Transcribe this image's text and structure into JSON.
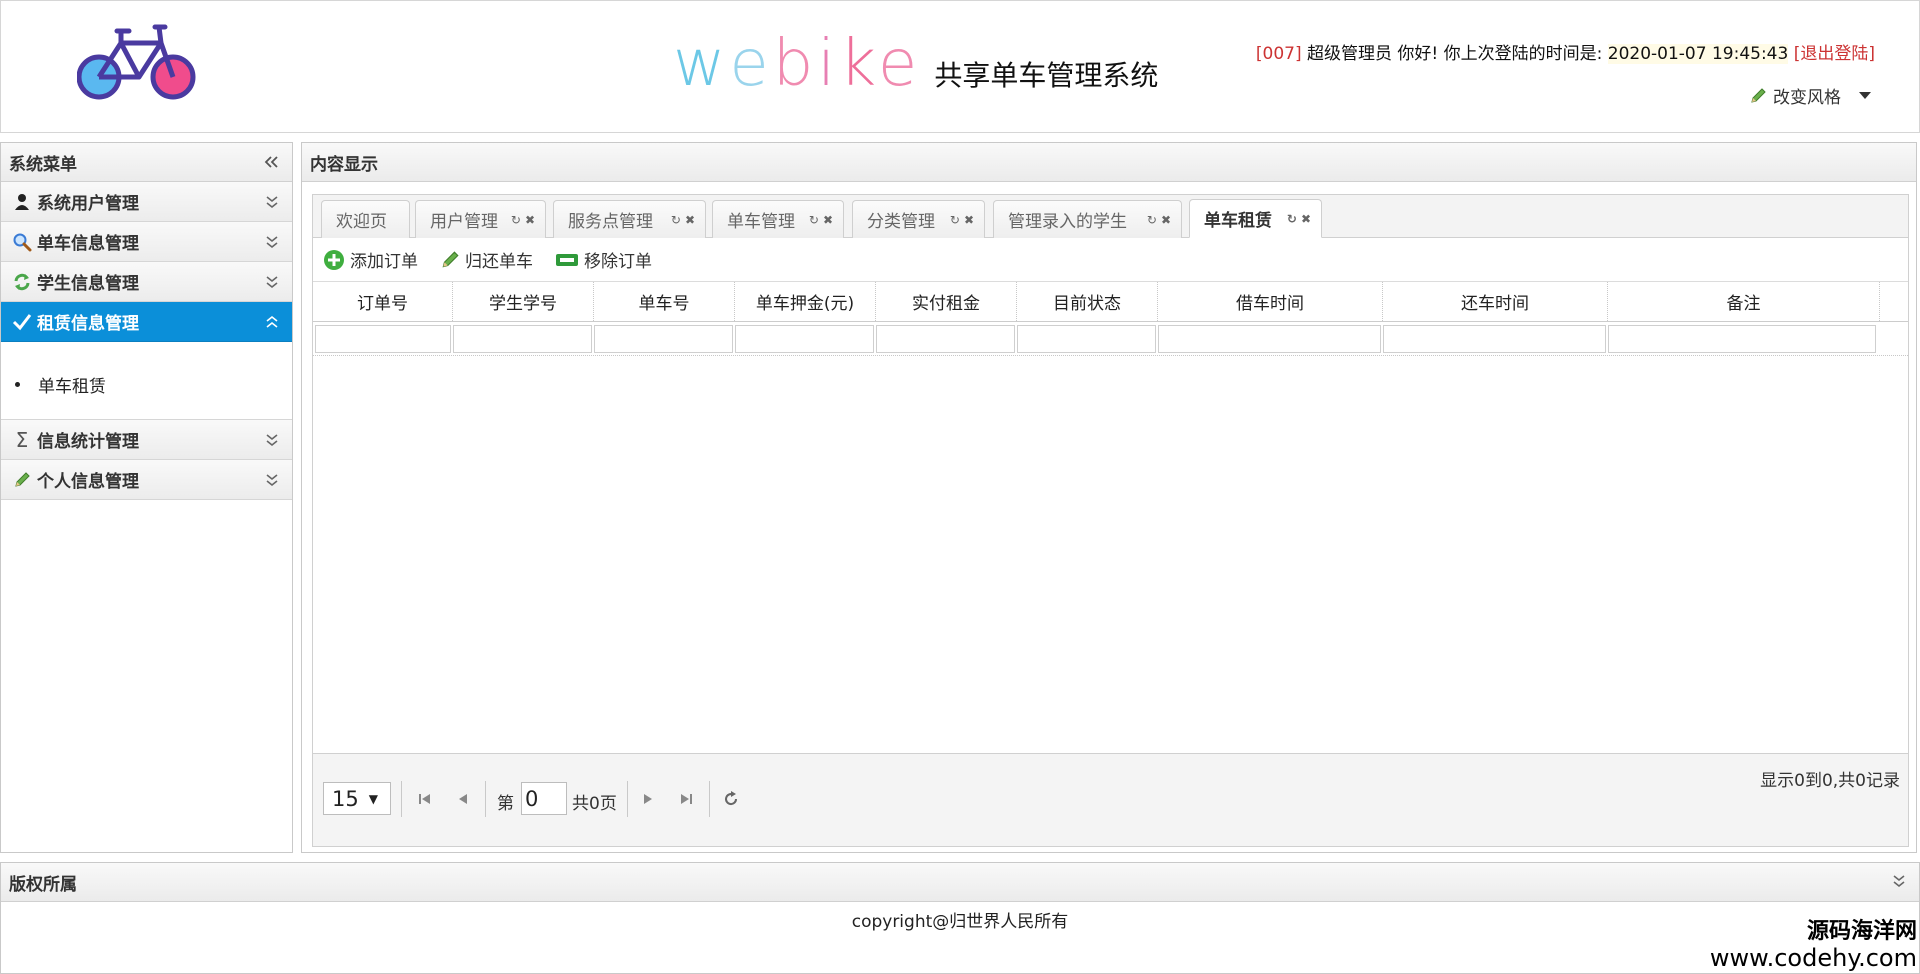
{
  "header": {
    "brand_word": [
      "w",
      "e",
      "b",
      "i",
      "k",
      "e"
    ],
    "brand_sub": "共享单车管理系统",
    "user_id": "[007]",
    "user_name": "超级管理员",
    "greeting": "你好! 你上次登陆的时间是:",
    "login_time": "2020-01-07 19:45:43",
    "logout": "[退出登陆]",
    "style_switch": "改变风格"
  },
  "sidebar": {
    "title": "系统菜单",
    "items": [
      {
        "label": "系统用户管理",
        "icon": "user-icon"
      },
      {
        "label": "单车信息管理",
        "icon": "magnifier-icon"
      },
      {
        "label": "学生信息管理",
        "icon": "refresh-arrows-icon"
      },
      {
        "label": "租赁信息管理",
        "icon": "checkmark-icon",
        "selected": true,
        "children": [
          "单车租赁"
        ]
      },
      {
        "label": "信息统计管理",
        "icon": "sigma-icon"
      },
      {
        "label": "个人信息管理",
        "icon": "pencil-icon"
      }
    ]
  },
  "content": {
    "title": "内容显示",
    "tabs": [
      {
        "label": "欢迎页",
        "closable": false
      },
      {
        "label": "用户管理",
        "closable": true
      },
      {
        "label": "服务点管理",
        "closable": true
      },
      {
        "label": "单车管理",
        "closable": true
      },
      {
        "label": "分类管理",
        "closable": true
      },
      {
        "label": "管理录入的学生",
        "closable": true
      },
      {
        "label": "单车租赁",
        "closable": true,
        "active": true
      }
    ],
    "toolbar": {
      "add": "添加订单",
      "return": "归还单车",
      "remove": "移除订单"
    },
    "grid": {
      "columns": [
        "订单号",
        "学生学号",
        "单车号",
        "单车押金(元)",
        "实付租金",
        "目前状态",
        "借车时间",
        "还车时间",
        "备注"
      ]
    },
    "pager": {
      "page_size": "15",
      "page_label": "第",
      "page_value": "0",
      "page_total": "共0页",
      "info": "显示0到0,共0记录"
    }
  },
  "footer": {
    "title": "版权所属",
    "copyright": "copyright@归世界人民所有",
    "watermark_cn": "源码海洋网",
    "watermark_url": "www.codehy.com"
  },
  "colors": {
    "accent": "#0b8fd9",
    "logout": "#cc3333"
  }
}
